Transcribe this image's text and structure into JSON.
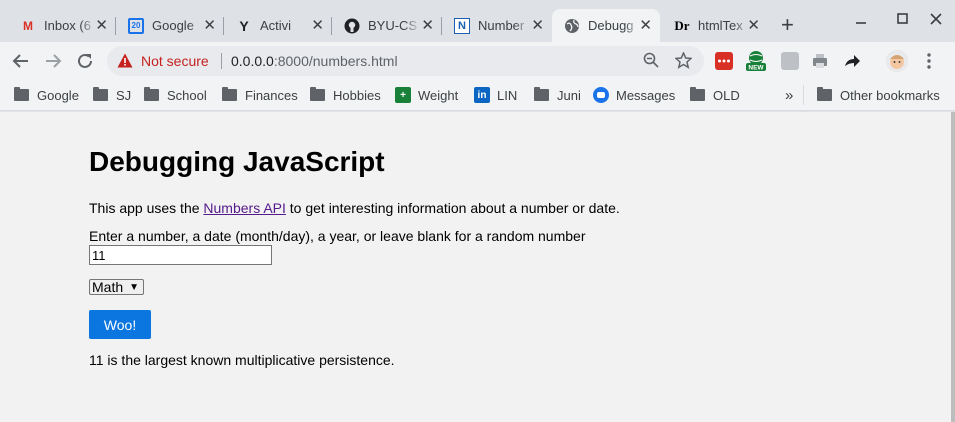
{
  "tabs": [
    {
      "title": "Inbox (6",
      "icon": "gmail-icon",
      "color": "#d93025"
    },
    {
      "title": "Google",
      "icon": "calendar-icon",
      "color": "#1a73e8"
    },
    {
      "title": "Activi",
      "icon": "yahoo-icon",
      "color": "#3c4043"
    },
    {
      "title": "BYU-CS",
      "icon": "github-icon",
      "color": "#202124"
    },
    {
      "title": "Number",
      "icon": "notion-icon",
      "color": "#1a5fb4"
    },
    {
      "title": "Debugg",
      "icon": "globe-icon",
      "color": "#5f6368"
    },
    {
      "title": "htmlTex",
      "icon": "dr-icon",
      "color": "#3c4043"
    }
  ],
  "address_bar": {
    "security": "Not secure",
    "host": "0.0.0.0",
    "path": ":8000/numbers.html"
  },
  "bookmarks": [
    {
      "label": "Google",
      "type": "folder"
    },
    {
      "label": "SJ",
      "type": "folder"
    },
    {
      "label": "School",
      "type": "folder"
    },
    {
      "label": "Finances",
      "type": "folder"
    },
    {
      "label": "Hobbies",
      "type": "folder"
    },
    {
      "label": "Weight",
      "type": "site"
    },
    {
      "label": "LIN",
      "type": "site"
    },
    {
      "label": "Juni",
      "type": "folder"
    },
    {
      "label": "Messages",
      "type": "site"
    },
    {
      "label": "OLD",
      "type": "folder"
    },
    {
      "label": "Other bookmarks",
      "type": "folder"
    }
  ],
  "overflow_label": "»",
  "page": {
    "title": "Debugging JavaScript",
    "intro_before": "This app uses the ",
    "intro_link": "Numbers API",
    "intro_after": " to get interesting information about a number or date.",
    "prompt": "Enter a number, a date (month/day), a year, or leave blank for a random number",
    "input_value": "11",
    "select_value": "Math",
    "button_label": "Woo!",
    "result": "11 is the largest known multiplicative persistence."
  }
}
